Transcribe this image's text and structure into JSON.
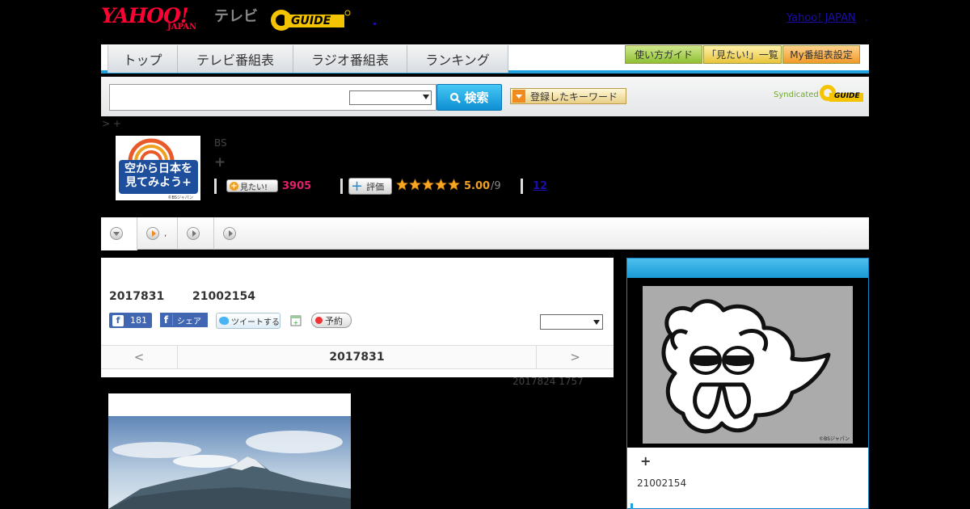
{
  "header": {
    "yahoo_logo_main": "YAHOO!",
    "yahoo_logo_sub": "JAPAN",
    "tv_label": "テレビ",
    "gguide_logo_text": "GUIDE",
    "yahoo_japan_link": "Yahoo! JAPAN",
    "separator": "."
  },
  "global_nav": {
    "tabs": [
      {
        "label": "トップ"
      },
      {
        "label": "テレビ番組表"
      },
      {
        "label": "ラジオ番組表"
      },
      {
        "label": "ランキング"
      }
    ],
    "buttons": [
      {
        "label": "使い方ガイド"
      },
      {
        "label": "「見たい!」一覧"
      },
      {
        "label": "My番組表設定"
      }
    ]
  },
  "search": {
    "input_value": "",
    "select_value": "",
    "button_label": "検索",
    "keyword_button_label": "登録したキーワード",
    "syndicated_label": "Syndicated",
    "syndicated_logo_text": "GUIDE"
  },
  "breadcrumb": "> +",
  "program": {
    "image_caption": "空から日本を見てみよう+",
    "image_copyright": "©BSジャパン",
    "channel": "BS",
    "title": "+",
    "want_button_label": "見たい!",
    "want_count": "3905",
    "rate_button_label": "評価",
    "rating": "5.00",
    "rating_denominator": "/9",
    "review_count": "12"
  },
  "sub_tabs": [
    {
      "label": ""
    },
    {
      "label": ","
    },
    {
      "label": ""
    },
    {
      "label": ""
    }
  ],
  "broadcast": {
    "date": "2017831",
    "time": "21002154",
    "fb_like_count": "181",
    "fb_share_label": "シェア",
    "tweet_label": "ツイートする",
    "reserve_label": "予約",
    "select_value": "",
    "prev_label": "<",
    "nav_date": "2017831",
    "next_label": ">",
    "updated": "2017824  1757"
  },
  "side_panel": {
    "image_copyright": "©BSジャパン",
    "title": "+",
    "time": "21002154"
  },
  "colors": {
    "accent_blue": "#1ea0dc",
    "want_count": "#e0206a",
    "rating": "#f0a020",
    "yahoo_red": "#ff0033",
    "gguide_yellow": "#f5c400"
  }
}
